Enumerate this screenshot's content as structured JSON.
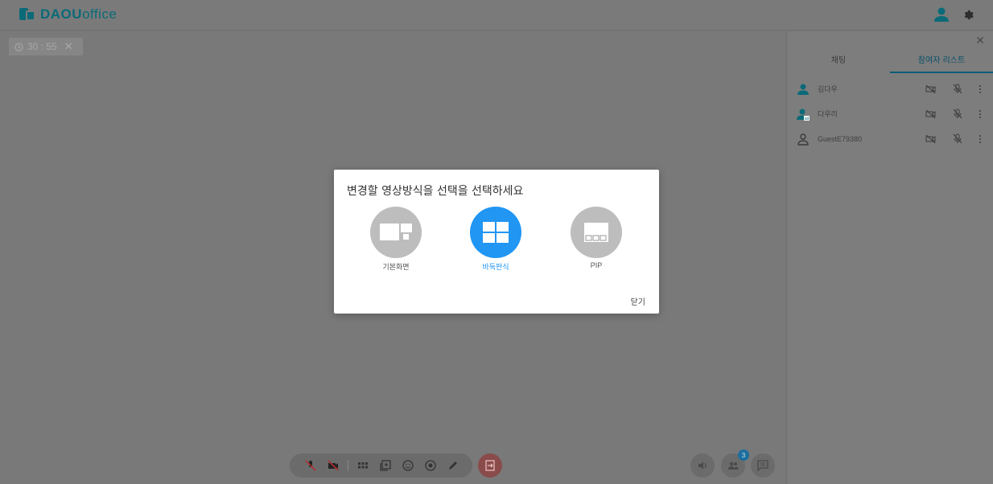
{
  "header": {
    "logo_brand": "DAOU",
    "logo_product": "office"
  },
  "timer": {
    "value": "30 : 55",
    "close": "✕"
  },
  "panel": {
    "close": "✕",
    "tabs": [
      {
        "label": "채팅",
        "active": false
      },
      {
        "label": "참여자 리스트",
        "active": true
      }
    ],
    "participants": [
      {
        "name": "김다우",
        "avatar": "person-teal"
      },
      {
        "name": "다우리",
        "avatar": "person-teal-badge"
      },
      {
        "name": "GuestE79380",
        "avatar": "person-outline"
      }
    ]
  },
  "modal": {
    "title": "변경할 영상방식을 선택을 선택하세요",
    "options": [
      {
        "label": "기본화면",
        "selected": false
      },
      {
        "label": "바둑판식",
        "selected": true
      },
      {
        "label": "PIP",
        "selected": false
      }
    ],
    "close_label": "닫기"
  },
  "badge_count": "3",
  "colors": {
    "accent": "#2196f3",
    "brand": "#0a6a78",
    "inactive_option": "#bdbdbd",
    "exit": "#8a4b4b"
  }
}
